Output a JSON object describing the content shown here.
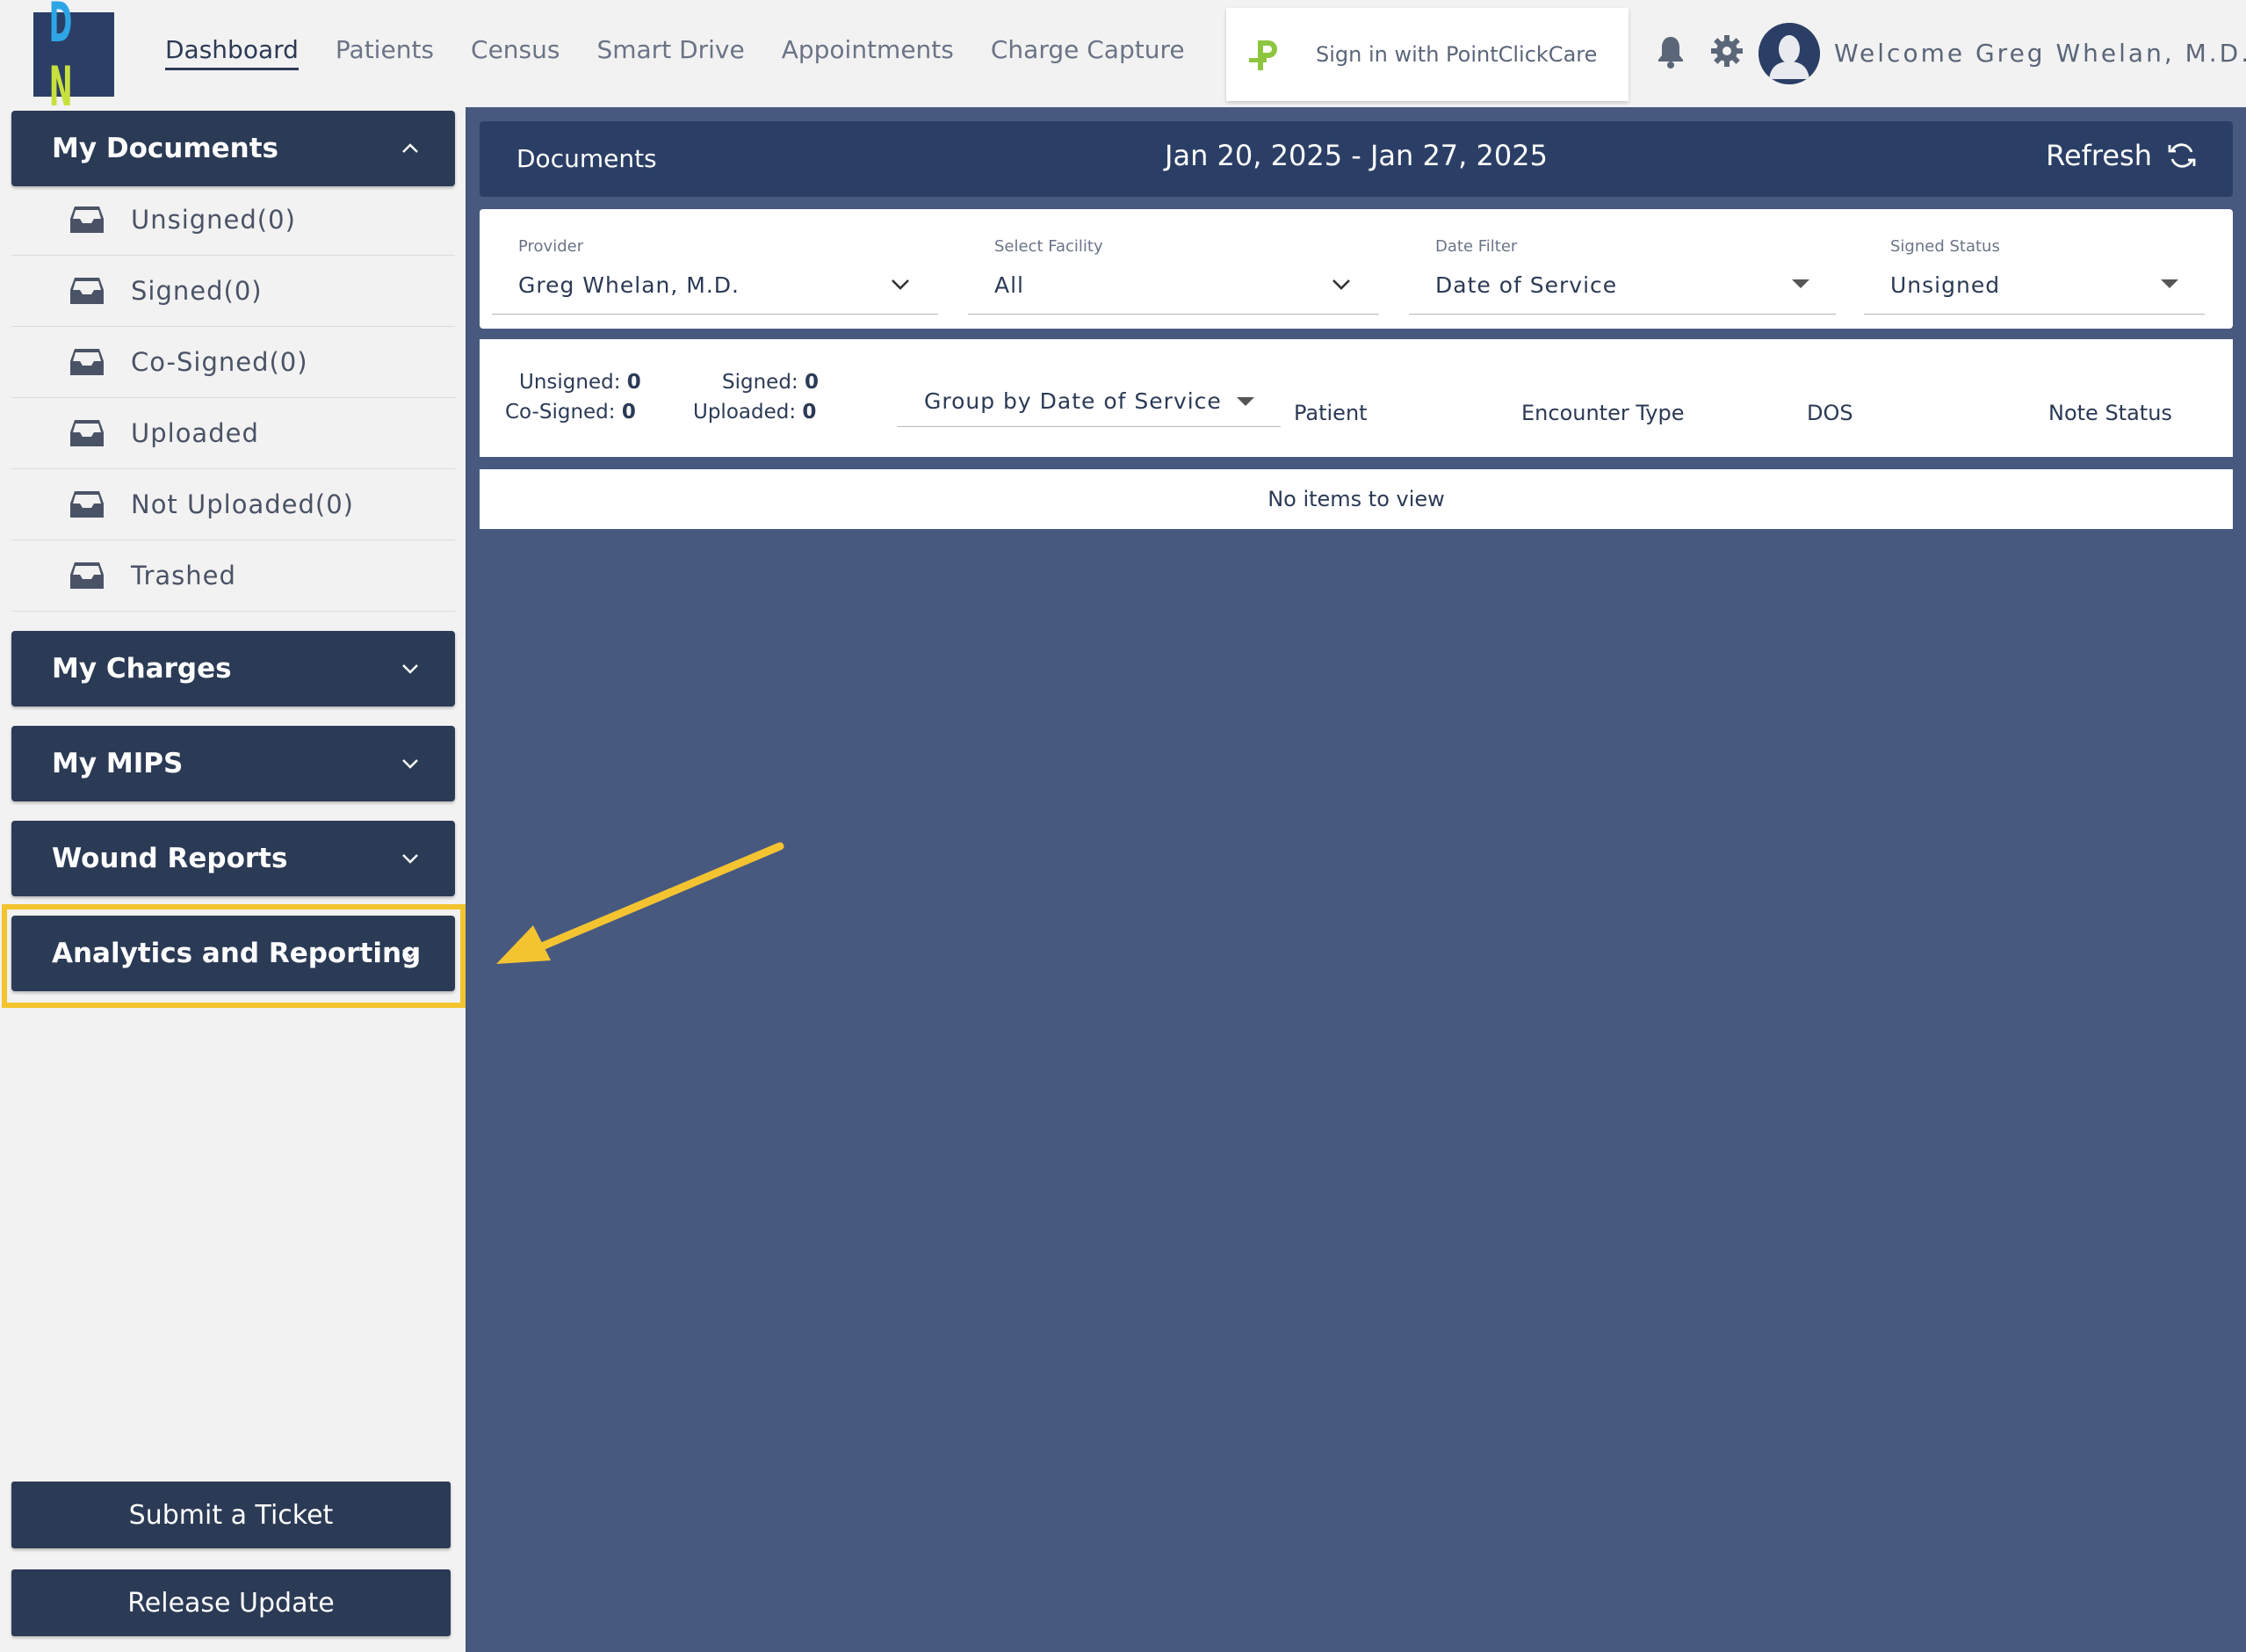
{
  "logo": {
    "left": "D",
    "right": "N"
  },
  "nav": {
    "items": [
      {
        "label": "Dashboard",
        "active": true
      },
      {
        "label": "Patients"
      },
      {
        "label": "Census"
      },
      {
        "label": "Smart Drive"
      },
      {
        "label": "Appointments"
      },
      {
        "label": "Charge Capture"
      }
    ]
  },
  "pcc": {
    "label": "Sign in with PointClickCare"
  },
  "user": {
    "welcome": "Welcome Greg Whelan, M.D."
  },
  "sidebar": {
    "my_documents": {
      "title": "My Documents",
      "items": [
        {
          "label": "Unsigned(0)"
        },
        {
          "label": "Signed(0)"
        },
        {
          "label": "Co-Signed(0)"
        },
        {
          "label": "Uploaded"
        },
        {
          "label": "Not Uploaded(0)"
        },
        {
          "label": "Trashed"
        }
      ]
    },
    "my_charges": "My Charges",
    "my_mips": "My MIPS",
    "wound_reports": "Wound Reports",
    "analytics": "Analytics and Reporting",
    "submit_ticket": "Submit a Ticket",
    "release_update": "Release Update"
  },
  "documents": {
    "title": "Documents",
    "date_range": "Jan 20, 2025 - Jan 27, 2025",
    "refresh": "Refresh"
  },
  "filters": {
    "provider": {
      "label": "Provider",
      "value": "Greg Whelan, M.D."
    },
    "facility": {
      "label": "Select Facility",
      "value": "All"
    },
    "date_filter": {
      "label": "Date Filter",
      "value": "Date of Service"
    },
    "signed_status": {
      "label": "Signed Status",
      "value": "Unsigned"
    }
  },
  "counts": {
    "unsigned_label": "Unsigned:",
    "unsigned": "0",
    "signed_label": "Signed:",
    "signed": "0",
    "cosigned_label": "Co-Signed:",
    "cosigned": "0",
    "uploaded_label": "Uploaded:",
    "uploaded": "0"
  },
  "table": {
    "group_by": "Group by Date of Service",
    "columns": [
      "Patient",
      "Encounter Type",
      "DOS",
      "Note Status"
    ],
    "empty": "No items to view"
  },
  "colors": {
    "accent": "#2b3a55",
    "highlight": "#f4c430",
    "main_bg": "#47597f"
  }
}
